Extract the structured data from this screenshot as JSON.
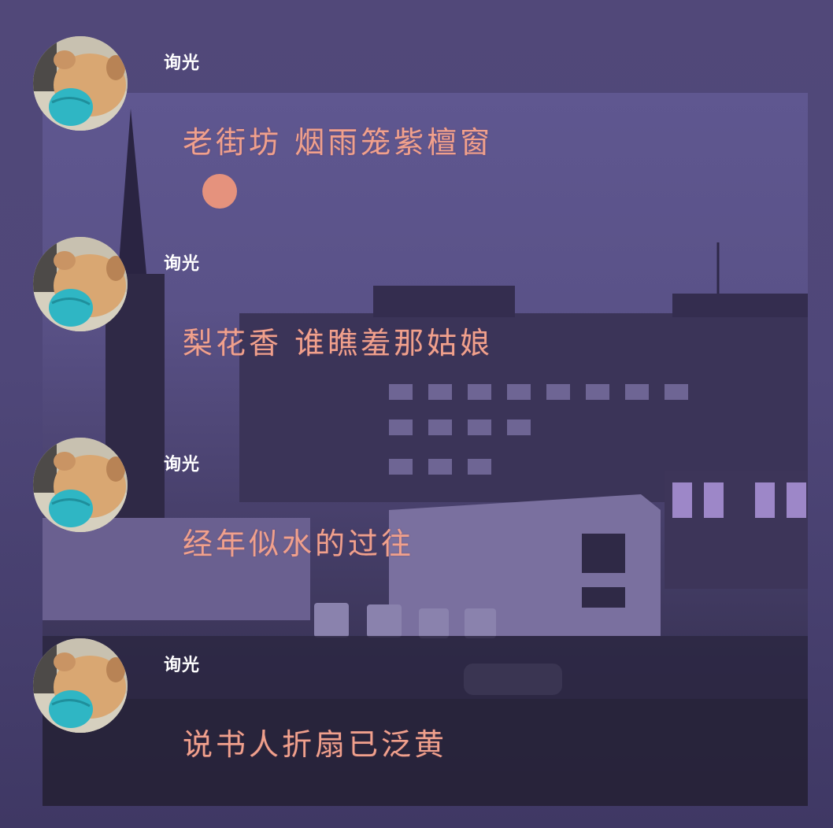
{
  "messages": [
    {
      "sender": "询光",
      "text": "老街坊 烟雨笼紫檀窗"
    },
    {
      "sender": "询光",
      "text": "梨花香 谁瞧羞那姑娘"
    },
    {
      "sender": "询光",
      "text": "经年似水的过往"
    },
    {
      "sender": "询光",
      "text": "说书人折扇已泛黄"
    }
  ],
  "colors": {
    "background": "#4e4677",
    "message_text": "#f0a08c",
    "name_text": "#ffffff",
    "mask": "#2fb6c4"
  },
  "icons": {
    "avatar": "dog-with-mask-avatar"
  }
}
